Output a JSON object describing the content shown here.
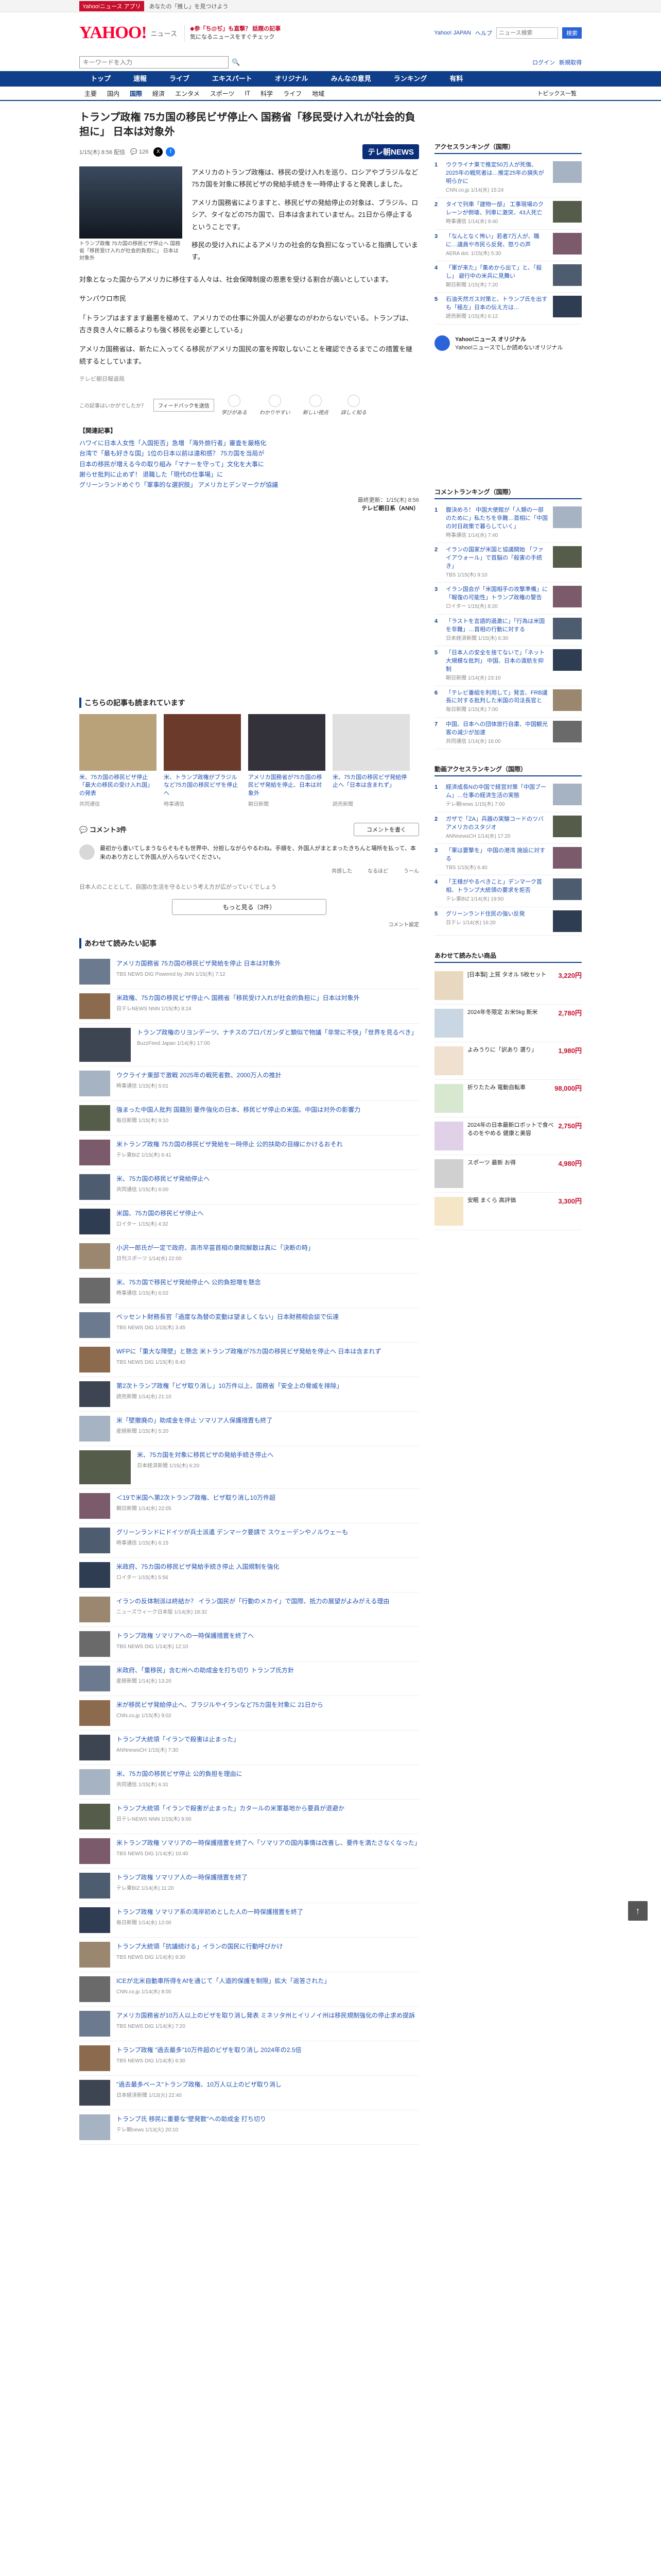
{
  "topbar": {
    "promo": "Yahoo!ニュース アプリ",
    "left_note": "あなたの「推し」を見つけよう"
  },
  "header": {
    "logo": "YAHOO!",
    "logo_sub": "ニュース",
    "promo_line1": "◆参「ち@ぢ」も直撃？ 話題の記事",
    "promo_line2": "気になるニュースをすぐチェック",
    "links": [
      "Yahoo! JAPAN",
      "ヘルプ"
    ],
    "search_placeholder": "ニュース検索",
    "search_btn": "検索"
  },
  "search": {
    "placeholder": "キーワードを入力",
    "right_links": [
      "ログイン",
      "新規取得"
    ]
  },
  "nav": [
    "トップ",
    "速報",
    "ライブ",
    "エキスパート",
    "オリジナル",
    "みんなの意見",
    "ランキング",
    "有料"
  ],
  "subnav": [
    "主要",
    "国内",
    "国際",
    "経済",
    "エンタメ",
    "スポーツ",
    "IT",
    "科学",
    "ライフ",
    "地域"
  ],
  "subnav_active": "国際",
  "subnav_topics": "トピックス一覧",
  "article": {
    "title": "トランプ政権 75カ国の移民ビザ停止へ 国務省「移民受け入れが社会的負担に」 日本は対象外",
    "date": "1/15(木) 8:56 配信",
    "comments": "126",
    "tvlogo": "テレ朝NEWS",
    "photo_caption": "トランプ政権 75カ国の移民ビザ停止へ 国務省「移民受け入れが社会的負担に」 日本は対象外",
    "lead": [
      "アメリカのトランプ政権は、移民の受け入れを巡り、ロシアやブラジルなど75カ国を対象に移民ビザの発給手続きを一時停止すると発表しました。",
      "アメリカ国務省によりますと、移民ビザの発給停止の対象は、ブラジル、ロシア、タイなどの75カ国で、日本は含まれていません。21日から停止するということです。",
      "移民の受け入れによるアメリカの社会的な負担になっていると指摘しています。"
    ],
    "body": [
      "対象となった国からアメリカに移住する人々は、社会保障制度の恩恵を受ける割合が高いとしています。",
      "サンパウロ市民",
      "「トランプはますます最悪を極めて、アメリカでの仕事に外国人が必要なのがわからないでいる。トランプは、古き良き人々に頼るよりも強く移民を必要としている」",
      "アメリカ国務省は、新たに入ってくる移民がアメリカ国民の富を搾取しないことを確認できるまでこの措置を継続するとしています。"
    ],
    "source_note": "テレビ朝日報道局",
    "ad_note": "この記事はいかがでしたか？",
    "ad_button": "フィードバックを送信",
    "reactions": [
      "学びがある",
      "わかりやすい",
      "新しい視点",
      "詳しく知る"
    ],
    "related_head": "【関連記事】",
    "related": [
      "ハワイに日本人女性「入国拒否」急増 「海外旅行者」審査を厳格化",
      "台湾で「最も好きな国」1位の日本以前は違和感？ 75カ国を当局が",
      "日本の移民が増える今の取り組み「マナーを守って」文化を大事に",
      "謝らせ批判に止めず！ 退職した「現代の仕事場」に",
      "グリーンランドめぐり「軍事的な選択肢」 アメリカとデンマークが協議"
    ],
    "src_date": "最終更新：1/15(木) 8:56",
    "src_name": "テレビ朝日系（ANN）"
  },
  "recommended": {
    "title": "こちらの記事も読まれています",
    "cards": [
      {
        "title": "米、75カ国の移民ビザ停止 「最大の移民の受け入れ国」の発表",
        "src": "共同通信"
      },
      {
        "title": "米、トランプ政権がブラジルなど75カ国の移民ビザを停止へ",
        "src": "時事通信"
      },
      {
        "title": "アメリカ国務省が75カ国の移民ビザ発給を停止、日本は対象外",
        "src": "朝日新聞"
      },
      {
        "title": "米、75カ国の移民ビザ発給停止へ「日本は含まれず」",
        "src": "読売新聞"
      }
    ]
  },
  "comments": {
    "title": "コメント3件",
    "write_btn": "コメントを書く",
    "item": "最初から書いてしまうならそもそも世界中、分担しながらやるわね。手順を、外国人がまとまったきちんと場所を払って、本来のあり方として外国人が入らないでください。",
    "actions": [
      "共感した",
      "なるほど",
      "うーん"
    ],
    "note": "日本人のこととして、自国の生活を守るという考え方が広がっていくでしょう",
    "more_btn": "もっと見る（3件）",
    "setting": "コメント設定"
  },
  "feed": {
    "title": "あわせて読みたい記事",
    "items": [
      {
        "title": "アメリカ国務省 75カ国の移民ビザ発給を停止 日本は対象外",
        "meta": "TBS NEWS DIG Powered by JNN 1/15(木) 7:12"
      },
      {
        "title": "米政権、75カ国の移民ビザ停止へ 国務省「移民受け入れが社会的負担に」日本は対象外",
        "meta": "日テレNEWS NNN 1/15(木) 8:24"
      },
      {
        "title": "トランプ政権のリヨンデーツ、ナチスのプロパガンダと類似で物議「非常に不快」「世界を見るべき」",
        "meta": "BuzzFeed Japan 1/14(水) 17:00"
      },
      {
        "title": "ウクライナ東部で激戦 2025年の戦死者数、2000万人の推計",
        "meta": "時事通信 1/15(木) 5:01"
      },
      {
        "title": "強まった中国人批判 国籍別 要件強化の日本、移民ビザ停止の米国。中国は対外の影響力",
        "meta": "毎日新聞 1/15(木) 9:10"
      },
      {
        "title": "米トランプ政権 75カ国の移民ビザ発給を一時停止 公的扶助の目線にかけるおそれ",
        "meta": "テレ東BIZ 1/15(木) 6:41"
      },
      {
        "title": "米、75カ国の移民ビザ発給停止へ",
        "meta": "共同通信 1/15(木) 6:00"
      },
      {
        "title": "米国、75カ国の移民ビザ停止へ",
        "meta": "ロイター 1/15(木) 4:32"
      },
      {
        "title": "小沢一郎氏が一定で政府、高市早苗首相の衆院解散は真に「決断の時」",
        "meta": "日刊スポーツ 1/14(水) 22:00"
      },
      {
        "title": "米、75カ国で移民ビザ発給停止へ 公的負担増を懸念",
        "meta": "時事通信 1/15(木) 6:02"
      },
      {
        "title": "ベッセント財務長官「過度な為替の変動は望ましくない」日本財務相会談で伝達",
        "meta": "TBS NEWS DIG 1/15(木) 3:45"
      },
      {
        "title": "WFPに「重大な障壁」と懸念 米トランプ政権が75カ国の移民ビザ発給を停止へ 日本は含まれず",
        "meta": "TBS NEWS DIG 1/15(木) 8:40"
      },
      {
        "title": "第2次トランプ政権「ビザ取り消し」10万件以上、国務省「安全上の脅威を排除」",
        "meta": "読売新聞 1/14(水) 21:10"
      },
      {
        "title": "米「壁撤廃の」助成金を停止 ソマリア人保護措置も終了",
        "meta": "産経新聞 1/15(木) 5:20"
      },
      {
        "title": "米、75カ国を対象に移民ビザの発給手続き停止へ",
        "meta": "日本経済新聞 1/15(木) 6:20"
      },
      {
        "title": "＜19で米国へ第2次トランプ政権、ビザ取り消し10万件超",
        "meta": "朝日新聞 1/14(水) 22:05"
      },
      {
        "title": "グリーンランドにドイツが兵士派遣 デンマーク要請で スウェーデンやノルウェーも",
        "meta": "時事通信 1/15(木) 6:15"
      },
      {
        "title": "米政府、75カ国の移民ビザ発給手続き停止 入国規制を強化",
        "meta": "ロイター 1/15(木) 5:56"
      },
      {
        "title": "イランの反体制派は終結か？ イラン国民が「行動のメカイ」で国際、抵力の展望がよみがえる理由",
        "meta": "ニューズウィーク日本版 1/14(水) 18:32"
      },
      {
        "title": "トランプ政権 ソマリアへの一時保護措置を終了へ",
        "meta": "TBS NEWS DIG 1/14(水) 12:10"
      },
      {
        "title": "米政府、「重移民」含む州への助成金を打ち切り トランプ氏方針",
        "meta": "産経新聞 1/14(水) 13:20"
      },
      {
        "title": "米が移民ビザ発給停止へ、ブラジルやイランなど75カ国を対象に 21日から",
        "meta": "CNN.co.jp 1/15(木) 9:02"
      },
      {
        "title": "トランプ大統領「イランで殺害は止まった」",
        "meta": "ANNnewsCH 1/15(木) 7:30"
      },
      {
        "title": "米、75カ国の移民ビザ停止 公的負担を理由に",
        "meta": "共同通信 1/15(木) 6:31"
      },
      {
        "title": "トランプ大統領「イランで殺害が止まった」カタールの米軍基地から要員が退避か",
        "meta": "日テレNEWS NNN 1/15(木) 9:00"
      },
      {
        "title": "米トランプ政権 ソマリアの一時保護措置を終了へ「ソマリアの国内事情は改善し、要件を満たさなくなった」",
        "meta": "TBS NEWS DIG 1/14(水) 10:40"
      },
      {
        "title": "トランプ政権 ソマリア人の一時保護措置を終了",
        "meta": "テレ東BIZ 1/14(水) 11:20"
      },
      {
        "title": "トランプ政権 ソマリア系の湾岸初めとした人の一時保護措置を終了",
        "meta": "毎日新聞 1/14(水) 12:00"
      },
      {
        "title": "トランプ大統領「抗議続ける」イランの国民に行動呼びかけ",
        "meta": "TBS NEWS DIG 1/14(水) 9:30"
      },
      {
        "title": "ICEが北米自動車所得をAfを通じて「人道的保護を制限」拡大「返答された」",
        "meta": "CNN.co.jp 1/14(水) 8:00"
      },
      {
        "title": "アメリカ国務省が10万人以上のビザを取り消し発表 ミネソタ州とイリノイ州は移民規制強化の停止求め提訴",
        "meta": "TBS NEWS DIG 1/14(水) 7:20"
      },
      {
        "title": "トランプ政権 \"過去最多\"10万件超のビザを取り消し 2024年の2.5倍",
        "meta": "TBS NEWS DIG 1/14(水) 6:30"
      },
      {
        "title": "\"過去最多ペース\"トランプ政権、10万人以上のビザ取り消し",
        "meta": "日本経済新聞 1/13(火) 22:40"
      },
      {
        "title": "トランプ氏 移民に重要な\"壁発散\"への助成金 打ち切り",
        "meta": "テレ朝news 1/13(火) 20:10"
      }
    ]
  },
  "sidebar": {
    "ranking_title": "アクセスランキング（国際）",
    "ranking": [
      {
        "text": "ウクライナ東で推定50万人が死傷、2025年の戦死者は…推定25年の損失が明らかに",
        "src": "CNN.co.jp 1/14(水) 15:24"
      },
      {
        "text": "タイで列車「建物一部」 工事現場のクレーンが倒壊、列車に激突、43人死亡",
        "src": "時事通信 1/14(水) 9:40"
      },
      {
        "text": "「なんとなく怖い」若者7万人が、職に…議員や市民ら反発、怒りの声",
        "src": "AERA dot. 1/15(木) 5:30"
      },
      {
        "text": "「軍が来た」「集めから出て」と、「殺し」 避行中の米兵に見舞い",
        "src": "朝日新聞 1/15(木) 7:20"
      },
      {
        "text": "石油天然ガス対策と、トランプ氏を出すも「極左」日本の伝え方は…",
        "src": "読売新聞 1/15(木) 6:12"
      }
    ],
    "banner": "Yahoo!ニュース オリジナル",
    "banner_sub": "Yahoo!ニュースでしか読めないオリジナル",
    "comment_ranking_title": "コメントランキング（国際）",
    "comment_ranking": [
      {
        "text": "腹決めろ！ 中国大使館が「人類の一部のために」私たちを非難…首相に「中国の対日政策で暮らしていく」",
        "src": "時事通信 1/14(水) 7:40"
      },
      {
        "text": "イランの国家が米国と協議開始 「ファイアウォール」で首脳の「殺害の手続き」",
        "src": "TBS 1/15(木) 9:10"
      },
      {
        "text": "イラン国会が「米国相手の攻撃準備」に「報復の可能性」トランプ政権の警告",
        "src": "ロイター 1/15(木) 8:20"
      },
      {
        "text": "「ラストを言語的過激に」「行為は米国を非難」…首相の行動に対する",
        "src": "日本経済新聞 1/15(木) 6:30"
      },
      {
        "text": "「日本人の安全を捨てないで」「ネット大規模な批判」 中国、日本の渡航を抑制",
        "src": "朝日新聞 1/14(水) 23:10"
      },
      {
        "text": "「テレビ番組を利用して」発言、FRB議長に対する批判した米国の司法長官と",
        "src": "毎日新聞 1/15(木) 7:00"
      },
      {
        "text": "中国、日本への団体旅行自粛、中国観光客の減少が加速",
        "src": "共同通信 1/14(水) 16:00"
      }
    ],
    "video_ranking_title": "動画アクセスランキング（国際）",
    "video_ranking": [
      {
        "text": "経済成長Nの中国で経営対策「中国ブーム」…仕事の経済生活の実態",
        "src": "テレ朝news 1/15(木) 7:00"
      },
      {
        "text": "ガザで「ZA」兵器の実験コードのツバ アメリカのスタジオ",
        "src": "ANNnewsCH 1/14(水) 17:20"
      },
      {
        "text": "「軍は要撃を」 中国の港湾 施設に対する",
        "src": "TBS 1/15(木) 6:40"
      },
      {
        "text": "「王様がやるべきこと」デンマーク首相、トランプ大統領の要求を拒否",
        "src": "テレ東BIZ 1/14(水) 19:50"
      },
      {
        "text": "グリーンランド住民の強い反発",
        "src": "日テレ 1/14(水) 16:20"
      }
    ],
    "shop_title": "あわせて読みたい商品",
    "shop": [
      {
        "text": "[日本製] 上質 タオル 5枚セット",
        "price": "3,220円"
      },
      {
        "text": "2024年冬限定 お米5kg 新米",
        "price": "2,780円"
      },
      {
        "text": "よみうりに「訳あり 選り」",
        "price": "1,980円"
      },
      {
        "text": "折りたたみ 電動自転車",
        "price": "98,000円"
      },
      {
        "text": "2024年の日本最新ロボットで食べるのをやめる 健康と美容",
        "price": "2,750円"
      },
      {
        "text": "スポーツ 最新 お得",
        "price": "4,980円"
      },
      {
        "text": "安眠 まくら 高評価",
        "price": "3,300円"
      }
    ]
  },
  "pagetop": "↑"
}
